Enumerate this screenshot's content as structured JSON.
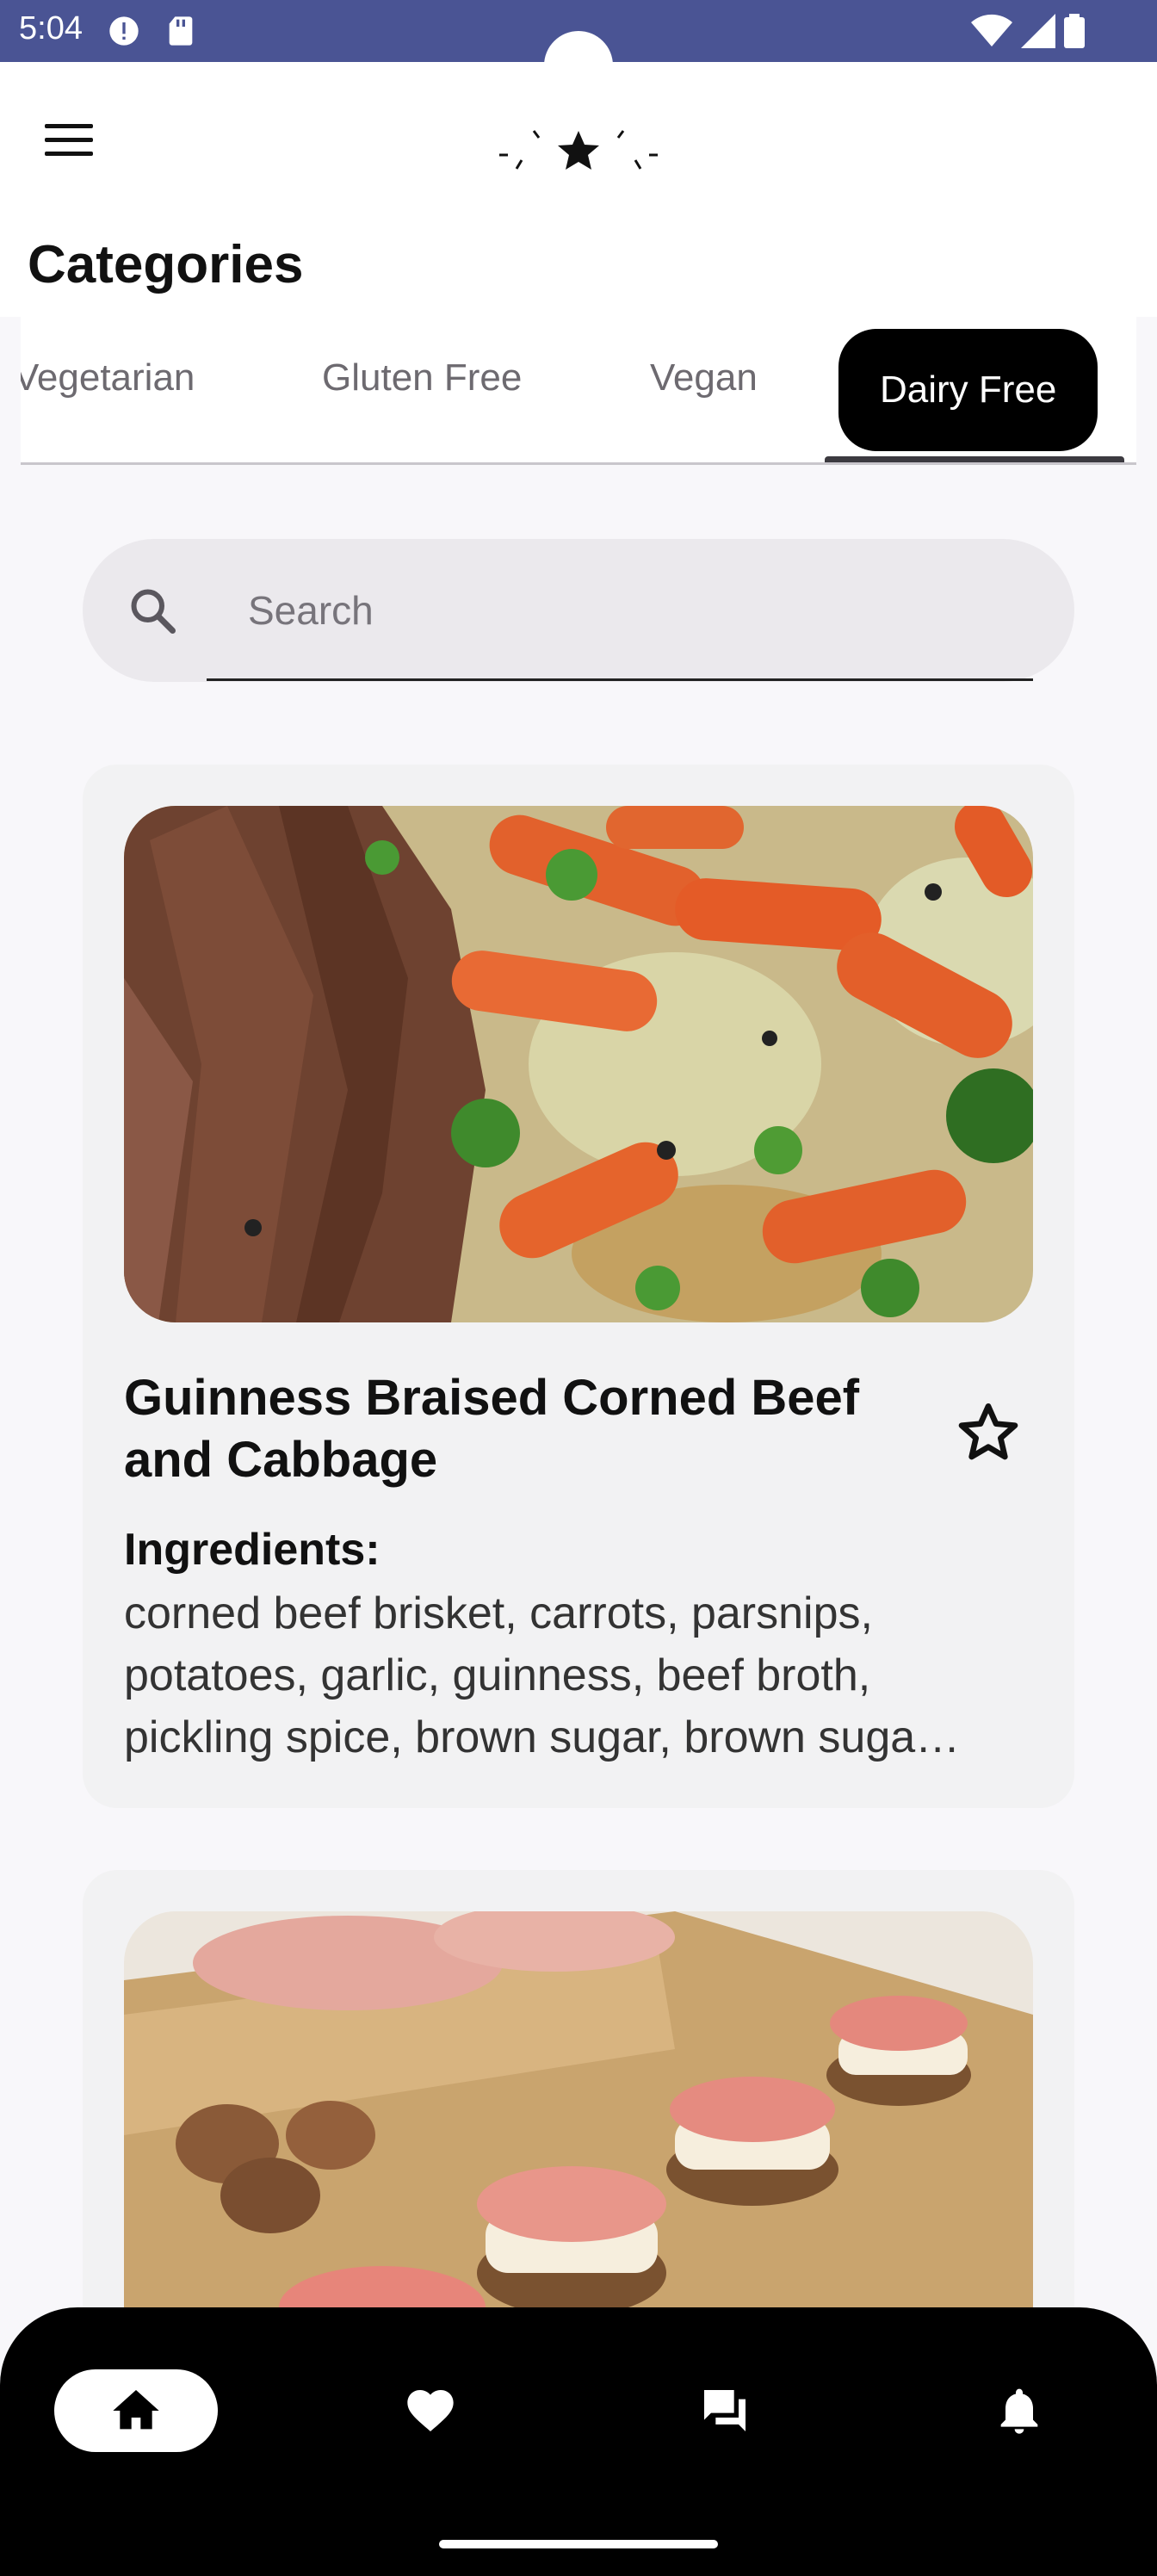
{
  "status_bar": {
    "time": "5:04",
    "icons": [
      "alert-circle-icon",
      "sd-card-icon",
      "wifi-icon",
      "signal-icon",
      "battery-icon"
    ]
  },
  "app_bar": {
    "menu_icon": "menu-icon",
    "logo_icon": "star-sparkle-logo"
  },
  "page": {
    "title": "Categories"
  },
  "tabs": {
    "items": [
      {
        "label": "Vegetarian",
        "selected": false
      },
      {
        "label": "Gluten Free",
        "selected": false
      },
      {
        "label": "Vegan",
        "selected": false
      },
      {
        "label": "Dairy Free",
        "selected": true
      }
    ]
  },
  "search": {
    "placeholder": "Search",
    "icon": "search-icon"
  },
  "recipes": [
    {
      "title": "Guinness Braised Corned Beef and Cabbage",
      "ingredients_label": "Ingredients:",
      "ingredients": "corned beef brisket, carrots, parsnips, potatoes, garlic, guinness, beef broth, pickling spice, brown sugar, brown suga…",
      "favorite": false,
      "image": "corned beef with carrots and cabbage"
    },
    {
      "image": "ham and cheese appetizer bites on wooden board"
    }
  ],
  "bottom_nav": {
    "items": [
      {
        "icon": "home-icon",
        "active": true
      },
      {
        "icon": "heart-icon",
        "active": false
      },
      {
        "icon": "chat-icon",
        "active": false
      },
      {
        "icon": "bell-icon",
        "active": false
      }
    ]
  },
  "colors": {
    "status_bar": "#4a5494",
    "background": "#f8f7fa",
    "selected_tab": "#000000",
    "card": "#f2f2f3",
    "bottom_nav": "#000000"
  }
}
